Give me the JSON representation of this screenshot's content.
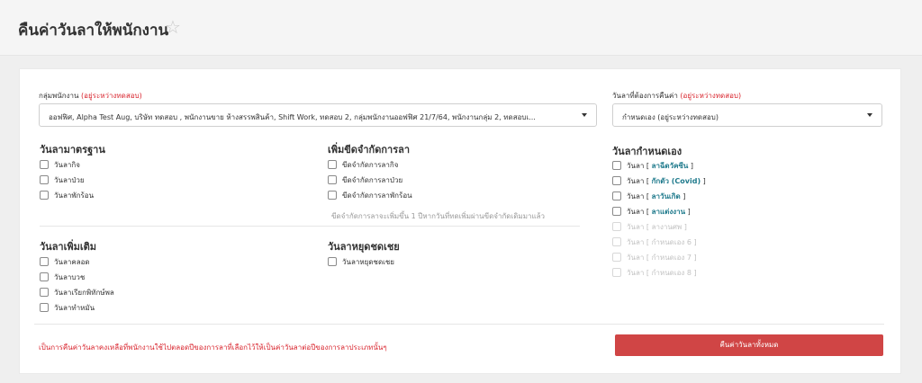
{
  "header": {
    "title": "คืนค่าวันลาให้พนักงาน",
    "favorite_icon": "star-outline-icon"
  },
  "group_field": {
    "label": "กลุ่มพนักงาน",
    "label_note": "(อยู่ระหว่างทดสอบ)",
    "value": "ออฟฟิศ, Alpha Test Aug, บริษัท ทดสอบ , พนักงานขาย ห้างสรรพสินค้า, Shift Work, ทดสอบ 2, กลุ่มพนักงานออฟฟิศ 21/7/64, พนักงานกลุ่ม 2, ทดสอบเ..."
  },
  "leave_source_field": {
    "label": "วันลาที่ต้องการคืนค่า",
    "label_note": "(อยู่ระหว่างทดสอบ)",
    "value": "กำหนดเอง (อยู่ระหว่างทดสอบ)"
  },
  "standard_leave": {
    "title": "วันลามาตรฐาน",
    "items": [
      "วันลากิจ",
      "วันลาป่วย",
      "วันลาพักร้อน"
    ]
  },
  "extend_limit": {
    "title": "เพิ่มขีดจำกัดการลา",
    "items": [
      "ขีดจำกัดการลากิจ",
      "ขีดจำกัดการลาป่วย",
      "ขีดจำกัดการลาพักร้อน"
    ],
    "hint": "ขีดจำกัดการลาจะเพิ่มขึ้น 1 ปีหากวันที่ทดเพิ่มผ่านขีดจำกัดเดิมมาแล้ว"
  },
  "extra_leave": {
    "title": "วันลาเพิ่มเติม",
    "items": [
      "วันลาคลอด",
      "วันลาบวช",
      "วันลาเรียกพิทักษ์พล",
      "วันลาทำหมัน"
    ]
  },
  "compensatory_leave": {
    "title": "วันลาหยุดชดเชย",
    "items": [
      "วันลาหยุดชดเชย"
    ]
  },
  "custom_leave": {
    "title": "วันลากำหนดเอง",
    "prefix": "วันลา",
    "items": [
      {
        "name": "ลาฉีดวัคซีน",
        "enabled": true
      },
      {
        "name": "กักตัว (Covid)",
        "enabled": true
      },
      {
        "name": "ลาวันเกิด",
        "enabled": true
      },
      {
        "name": "ลาแต่งงาน",
        "enabled": true
      },
      {
        "name": "ลางานศพ",
        "enabled": false
      },
      {
        "name": "กำหนดเอง 6",
        "enabled": false
      },
      {
        "name": "กำหนดเอง 7",
        "enabled": false
      },
      {
        "name": "กำหนดเอง 8",
        "enabled": false
      }
    ]
  },
  "footer": {
    "note": "เป็นการคืนค่าวันลาคงเหลือที่พนักงานใช้ไปตลอดปีของการลาที่เลือกไว้ให้เป็นค่าวันลาต่อปีของการลาประเภทนั้นๆ",
    "submit_label": "คืนค่าวันลาทั้งหมด"
  },
  "colors": {
    "accent_red": "#d04545",
    "note_red": "#d9262f",
    "tag_teal": "#1f7a8c"
  }
}
